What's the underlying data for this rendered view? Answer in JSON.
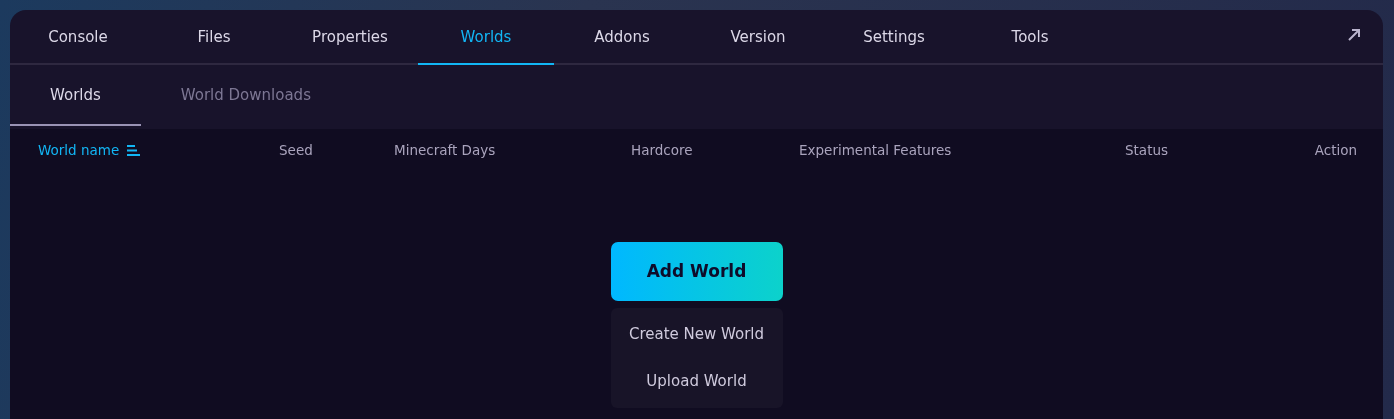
{
  "tabs": [
    {
      "label": "Console",
      "selected": false
    },
    {
      "label": "Files",
      "selected": false
    },
    {
      "label": "Properties",
      "selected": false
    },
    {
      "label": "Worlds",
      "selected": true
    },
    {
      "label": "Addons",
      "selected": false
    },
    {
      "label": "Version",
      "selected": false
    },
    {
      "label": "Settings",
      "selected": false
    },
    {
      "label": "Tools",
      "selected": false
    }
  ],
  "subtabs": [
    {
      "label": "Worlds",
      "selected": true
    },
    {
      "label": "World Downloads",
      "selected": false
    }
  ],
  "table": {
    "columns": [
      {
        "label": "World name",
        "sorted": true
      },
      {
        "label": "Seed",
        "sorted": false
      },
      {
        "label": "Minecraft Days",
        "sorted": false
      },
      {
        "label": "Hardcore",
        "sorted": false
      },
      {
        "label": "Experimental Features",
        "sorted": false
      },
      {
        "label": "Status",
        "sorted": false
      },
      {
        "label": "Action",
        "sorted": false
      }
    ]
  },
  "add_button": {
    "label": "Add World"
  },
  "add_menu": {
    "items": [
      "Create New World",
      "Upload World"
    ]
  }
}
